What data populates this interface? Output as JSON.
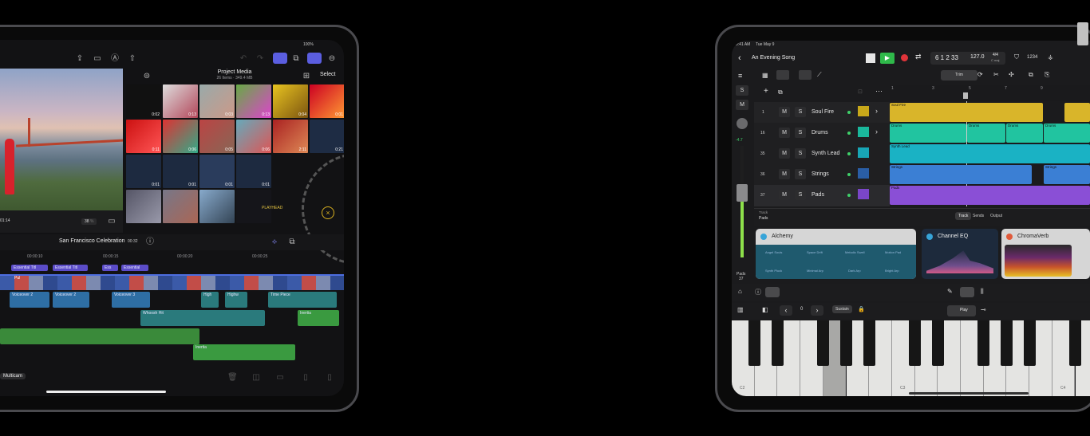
{
  "left_ipad": {
    "status_battery": "100%",
    "project_media": {
      "title": "Project Media",
      "subtitle": "26 Items · 349.4 MB",
      "select_label": "Select"
    },
    "viewer": {
      "timecode": "01:14",
      "zoom": "38",
      "zoom_unit": "%"
    },
    "media_thumbs": [
      "0:02",
      "0:13",
      "0:03",
      "0:13",
      "0:04",
      "0:01",
      "0:11",
      "0:06",
      "0:05",
      "0:06",
      "2:11",
      "0:21",
      "0:01",
      "0:01",
      "0:01",
      "0:01"
    ],
    "playhead_label": "PLAYHEAD",
    "project": {
      "name": "San Francisco Celebration",
      "duration": "00:32"
    },
    "ruler": [
      "00:00:10",
      "00:00:15",
      "00:00:20",
      "00:00:25"
    ],
    "title_clips": [
      "Essential Titl",
      "Essential Titl",
      "Ess",
      "Essential"
    ],
    "video_clip_label": "Pul",
    "audio_clips": [
      "Voiceover 2",
      "Voiceover 2",
      "Voiceover 3",
      "High",
      "Highw",
      "Time Piece",
      "Whoosh Hit",
      "Inertia",
      "Inertia"
    ],
    "multicam_label": "Multicam"
  },
  "right_ipad": {
    "status": {
      "time": "9:41 AM",
      "date": "Tue May 9"
    },
    "song_title": "An Evening Song",
    "lcd": {
      "position": "6 1 2 33",
      "tempo": "127.0",
      "signature": "4/4",
      "key": "C maj"
    },
    "count_in": "1234",
    "toolbar": {
      "trim_label": "Trim"
    },
    "side": {
      "s_label": "S",
      "m_label": "M",
      "meter_value": "-4.7",
      "track_name": "Pads",
      "track_num": "37"
    },
    "tracks": [
      {
        "num": "1",
        "name": "Soul Fire"
      },
      {
        "num": "16",
        "name": "Drums"
      },
      {
        "num": "35",
        "name": "Synth Lead"
      },
      {
        "num": "36",
        "name": "Strings"
      },
      {
        "num": "37",
        "name": "Pads"
      }
    ],
    "mute_label": "M",
    "solo_label": "S",
    "ruler": [
      "1",
      "3",
      "5",
      "7",
      "9"
    ],
    "regions": [
      "Soul Fire",
      "Drums",
      "Drums",
      "Drums",
      "Drums",
      "Synth Lead",
      "Strings",
      "Strings",
      "Pads"
    ],
    "inspector": {
      "header": "Track",
      "track_name": "Pads",
      "tabs": [
        "Track",
        "Sends",
        "Output"
      ]
    },
    "plugins": [
      {
        "name": "Alchemy",
        "accent": "#37a4d8"
      },
      {
        "name": "Channel EQ",
        "accent": "#37a4d8"
      },
      {
        "name": "ChromaVerb",
        "accent": "#e05a3a"
      }
    ],
    "alchemy_presets": [
      "Angel Souls",
      "Space Drift",
      "Melodic Swell",
      "Motion Pad",
      "Synth Pluck",
      "Minimal Arp",
      "Dark Arp",
      "Bright Arp"
    ],
    "keyboard": {
      "octave": "0",
      "sustain_label": "Sustain",
      "play_label": "Play",
      "labels": [
        "C2",
        "C3",
        "C4"
      ]
    }
  }
}
